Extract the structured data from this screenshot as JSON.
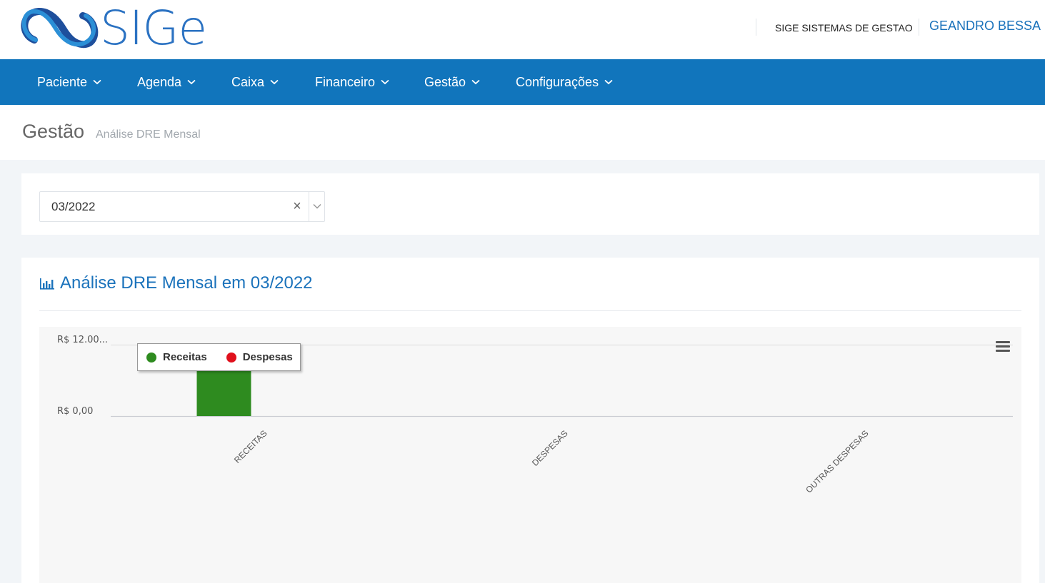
{
  "header": {
    "logo_text": "SIGe",
    "company": "SIGE SISTEMAS DE GESTAO",
    "user": "GEANDRO BESSA"
  },
  "nav": {
    "items": [
      {
        "label": "Paciente"
      },
      {
        "label": "Agenda"
      },
      {
        "label": "Caixa"
      },
      {
        "label": "Financeiro"
      },
      {
        "label": "Gestão"
      },
      {
        "label": "Configurações"
      }
    ]
  },
  "page": {
    "title": "Gestão",
    "subtitle": "Análise DRE Mensal"
  },
  "filter": {
    "selected": "03/2022",
    "clear_icon": "×"
  },
  "report": {
    "title": "Análise DRE Mensal em 03/2022",
    "icon": "bar-chart-icon"
  },
  "colors": {
    "primary": "#1175bc",
    "receitas": "#2e8b1f",
    "despesas": "#e0101c"
  },
  "chart_data": {
    "type": "bar",
    "categories": [
      "RECEITAS",
      "DESPESAS",
      "OUTRAS DESPESAS"
    ],
    "series": [
      {
        "name": "Receitas",
        "values": [
          12000,
          0,
          0
        ],
        "color": "#2e8b1f"
      },
      {
        "name": "Despesas",
        "values": [
          0,
          0,
          0
        ],
        "color": "#e0101c"
      }
    ],
    "y_ticks": [
      "R$ 0,00",
      "R$ 12.00..."
    ],
    "ylim": [
      0,
      12000
    ],
    "legend": "top-left",
    "grid": true
  }
}
